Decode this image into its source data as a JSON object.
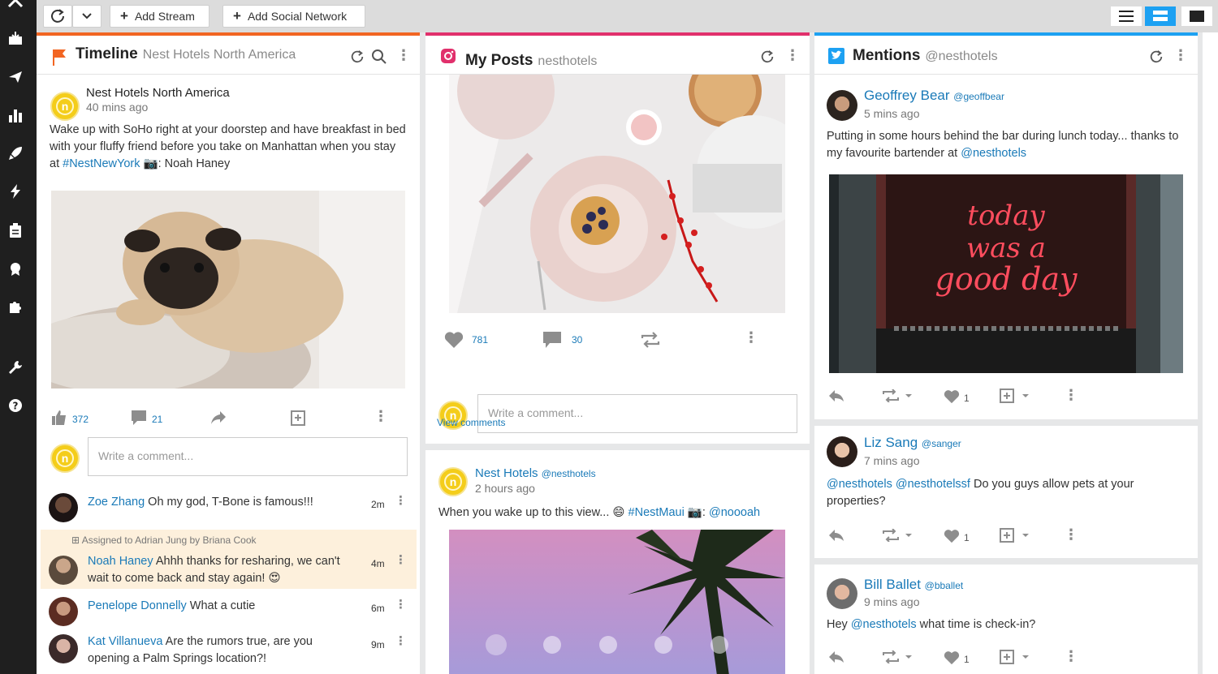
{
  "toolbar": {
    "add_stream": "Add Stream",
    "add_network": "Add Social Network"
  },
  "col1": {
    "title": "Timeline",
    "subtitle": "Nest Hotels North America",
    "post": {
      "author": "Nest Hotels North America",
      "time": "40 mins ago",
      "text_1": "Wake up with SoHo right at your doorstep and have breakfast in bed with your fluffy friend before you take on Manhattan when you stay at ",
      "hashtag": "#NestNewYork",
      "text_2": " 📷: Noah Haney",
      "likes": "372",
      "comments": "21",
      "comment_placeholder": "Write a comment..."
    },
    "comments": [
      {
        "name": "Zoe Zhang",
        "text": "Oh my god, T-Bone is famous!!!",
        "time": "2m"
      },
      {
        "name": "Noah Haney",
        "text": "Ahhh thanks for resharing, we can't wait to come back and stay again! 😍",
        "time": "4m",
        "assigned": "Assigned to Adrian Jung by Briana Cook"
      },
      {
        "name": "Penelope Donnelly",
        "text": "What a cutie",
        "time": "6m"
      },
      {
        "name": "Kat Villanueva",
        "text": "Are the rumors true, are you opening a Palm Springs location?!",
        "time": "9m"
      }
    ]
  },
  "col2": {
    "title": "My Posts",
    "subtitle": "nesthotels",
    "post1": {
      "likes": "781",
      "comments": "30",
      "comment_placeholder": "Write a comment...",
      "view_comments": "View comments"
    },
    "post2": {
      "author": "Nest Hotels",
      "handle": "@nesthotels",
      "time": "2 hours ago",
      "text": "When you wake up to this view... 😄 ",
      "hashtag": "#NestMaui",
      "camera": " 📷: ",
      "mention": "@noooah"
    }
  },
  "col3": {
    "title": "Mentions",
    "subtitle": "@nesthotels",
    "mentions": [
      {
        "name": "Geoffrey Bear",
        "handle": "@geoffbear",
        "time": "5 mins ago",
        "text": "Putting in some hours behind the bar during lunch today... thanks to my favourite bartender at ",
        "mention": "@nesthotels",
        "likes": "1"
      },
      {
        "name": "Liz Sang",
        "handle": "@sanger",
        "time": "7 mins ago",
        "mention1": "@nesthotels",
        "mention2": "@nesthotelssf",
        "text": " Do you guys allow pets at your properties?",
        "likes": "1"
      },
      {
        "name": "Bill Ballet",
        "handle": "@bballet",
        "time": "9 mins ago",
        "text1": "Hey ",
        "mention": "@nesthotels",
        "text2": " what time is check-in?",
        "likes": "1"
      }
    ],
    "neon_text": [
      "today",
      "was a",
      "good day"
    ]
  },
  "colors": {
    "timeline_accent": "#f26522",
    "instagram_accent": "#e1306c",
    "twitter_accent": "#1da1f2",
    "link": "#1a7ab8",
    "sidebar": "#1f1f1f"
  }
}
